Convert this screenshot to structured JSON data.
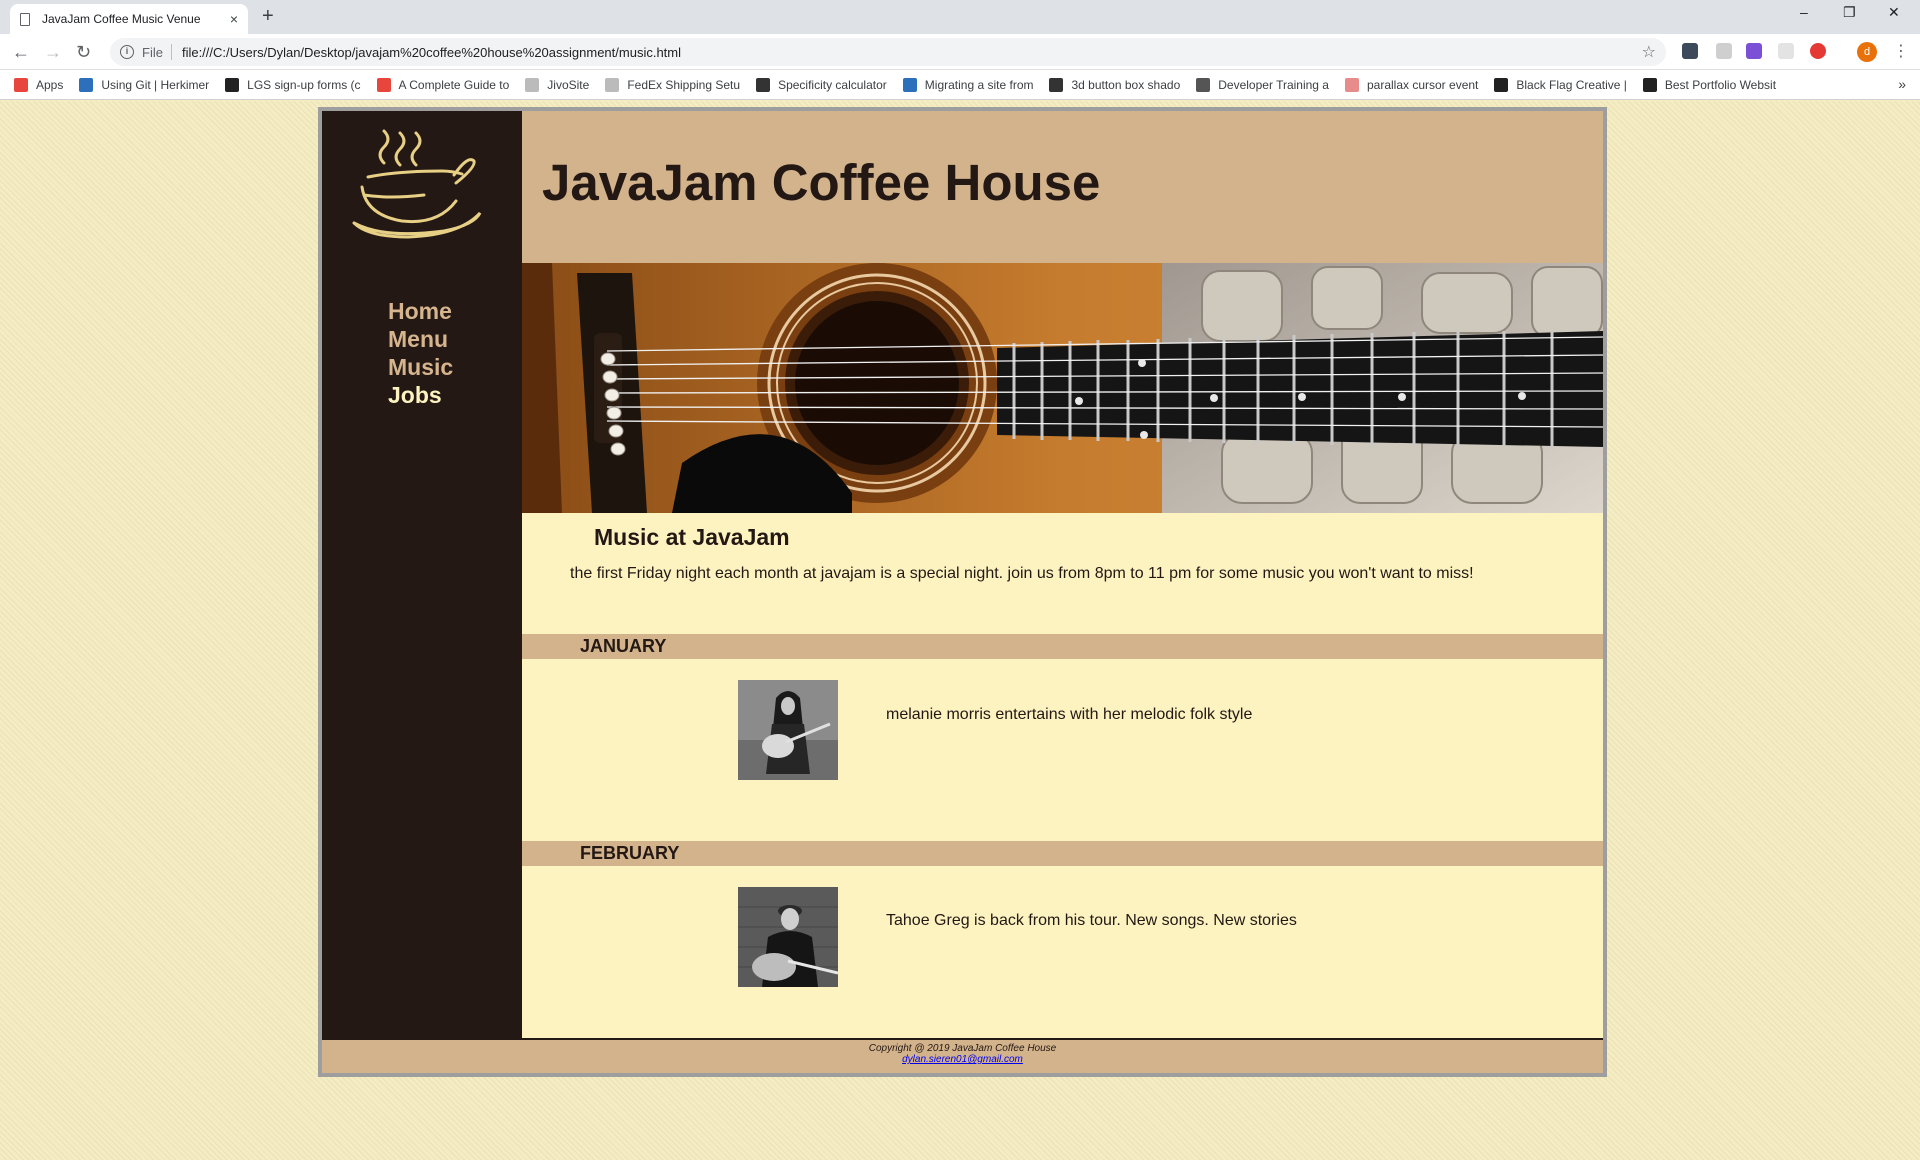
{
  "browser": {
    "tab_title": "JavaJam Coffee Music Venue",
    "tab_close": "×",
    "new_tab": "+",
    "window_controls": {
      "minimize": "–",
      "restore": "❐",
      "close": "✕"
    },
    "nav": {
      "back": "←",
      "forward": "→",
      "reload": "↻"
    },
    "address": {
      "scheme": "File",
      "url": "file:///C:/Users/Dylan/Desktop/javajam%20coffee%20house%20assignment/music.html",
      "info_icon": "i",
      "star": "☆"
    },
    "profile_initial": "d",
    "menu": "⋮",
    "bookmarks": [
      {
        "label": "Apps",
        "color": "#e8453c"
      },
      {
        "label": "Using Git | Herkimer",
        "color": "#2c6fbb"
      },
      {
        "label": "LGS sign-up forms (c",
        "color": "#222222"
      },
      {
        "label": "A Complete Guide to",
        "color": "#e8453c"
      },
      {
        "label": "JivoSite",
        "color": "#bbbbbb"
      },
      {
        "label": "FedEx Shipping Setu",
        "color": "#bbbbbb"
      },
      {
        "label": "Specificity calculator",
        "color": "#333333"
      },
      {
        "label": "Migrating a site from",
        "color": "#2c6fbb"
      },
      {
        "label": "3d button box shado",
        "color": "#333333"
      },
      {
        "label": "Developer Training a",
        "color": "#555555"
      },
      {
        "label": "parallax cursor event",
        "color": "#e88b8b"
      },
      {
        "label": "Black Flag Creative |",
        "color": "#222222"
      },
      {
        "label": "Best Portfolio Websit",
        "color": "#222222"
      }
    ],
    "bookmarks_more": "»"
  },
  "site": {
    "title": "JavaJam Coffee House",
    "nav": [
      {
        "label": "Home",
        "active": false
      },
      {
        "label": "Menu",
        "active": false
      },
      {
        "label": "Music",
        "active": false
      },
      {
        "label": "Jobs",
        "active": true
      }
    ],
    "heading": "Music at JavaJam",
    "intro": "the first Friday night each month at javajam is a special night. join us from 8pm to 11 pm for some music you won't want to miss!",
    "months": [
      {
        "name": "JANUARY",
        "text": "melanie morris entertains with her melodic folk style"
      },
      {
        "name": "FEBRUARY",
        "text": "Tahoe Greg is back from his tour. New songs. New stories"
      }
    ],
    "footer": {
      "copyright": "Copyright @ 2019 JavaJam Coffee House",
      "email": "dylan.sieren01@gmail.com"
    },
    "colors": {
      "dark": "#231814",
      "tan": "#d3b38c",
      "cream": "#fcf3c1",
      "nav_link": "#d5b48e"
    }
  }
}
